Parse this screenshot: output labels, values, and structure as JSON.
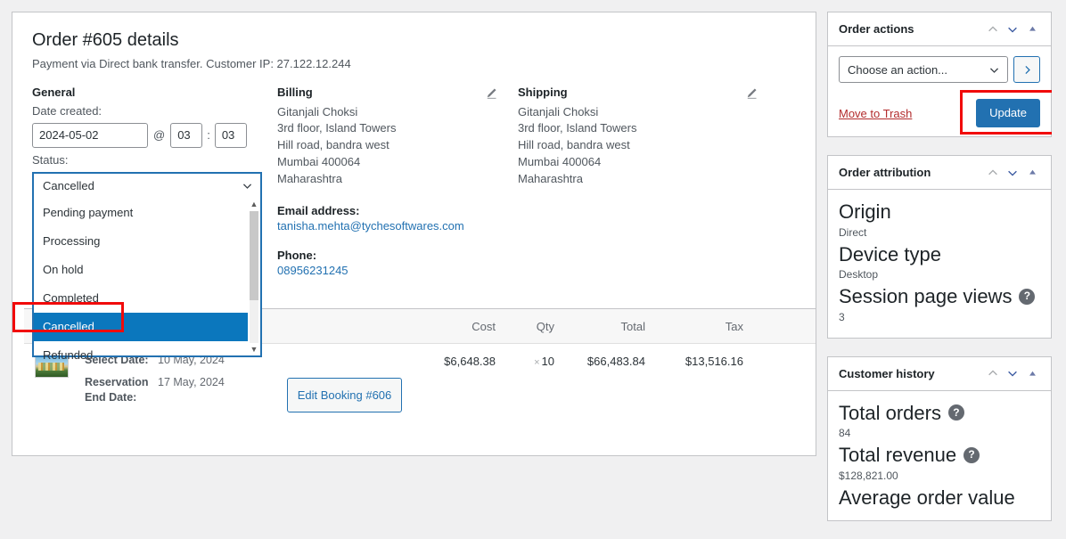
{
  "order": {
    "title": "Order #605 details",
    "subtitle": "Payment via Direct bank transfer. Customer IP: 27.122.12.244",
    "general_heading": "General",
    "date_created_label": "Date created:",
    "date_value": "2024-05-02",
    "at_symbol": "@",
    "hour_value": "03",
    "colon": ":",
    "minute_value": "03",
    "status_label": "Status:",
    "status_selected": "Cancelled",
    "status_options": [
      "Pending payment",
      "Processing",
      "On hold",
      "Completed",
      "Cancelled",
      "Refunded"
    ]
  },
  "billing": {
    "heading": "Billing",
    "lines": [
      "Gitanjali Choksi",
      "3rd floor, Island Towers",
      "Hill road, bandra west",
      "Mumbai 400064",
      "Maharashtra"
    ],
    "email_label": "Email address:",
    "email_value": "tanisha.mehta@tychesoftwares.com",
    "phone_label": "Phone:",
    "phone_value": "08956231245"
  },
  "shipping": {
    "heading": "Shipping",
    "lines": [
      "Gitanjali Choksi",
      "3rd floor, Island Towers",
      "Hill road, bandra west",
      "Mumbai 400064",
      "Maharashtra"
    ]
  },
  "items_table": {
    "headers": {
      "cost": "Cost",
      "qty": "Qty",
      "total": "Total",
      "tax": "Tax"
    },
    "row": {
      "meta": [
        {
          "key": "Select Date:",
          "value": "10 May, 2024"
        },
        {
          "key": "Reservation End Date:",
          "value": "17 May, 2024"
        }
      ],
      "edit_booking_label": "Edit Booking #606",
      "cost": "$6,648.38",
      "qty_multiplier": "×",
      "qty": "10",
      "total": "$66,483.84",
      "tax": "$13,516.16"
    }
  },
  "sidebar": {
    "order_actions": {
      "title": "Order actions",
      "action_select_value": "Choose an action...",
      "go_label": "›",
      "trash_label": "Move to Trash",
      "update_label": "Update"
    },
    "order_attribution": {
      "title": "Order attribution",
      "entries": [
        {
          "label": "Origin",
          "value": "Direct",
          "help": false
        },
        {
          "label": "Device type",
          "value": "Desktop",
          "help": false
        },
        {
          "label": "Session page views",
          "value": "3",
          "help": true
        }
      ]
    },
    "customer_history": {
      "title": "Customer history",
      "entries": [
        {
          "label": "Total orders",
          "value": "84",
          "help": true
        },
        {
          "label": "Total revenue",
          "value": "$128,821.00",
          "help": true
        },
        {
          "label": "Average order value",
          "value": "",
          "help": false
        }
      ]
    }
  },
  "colors": {
    "accent": "#2271b1",
    "highlight_red": "#f10b0b",
    "selected_blue": "#0b77bd",
    "danger": "#b32d2e"
  }
}
